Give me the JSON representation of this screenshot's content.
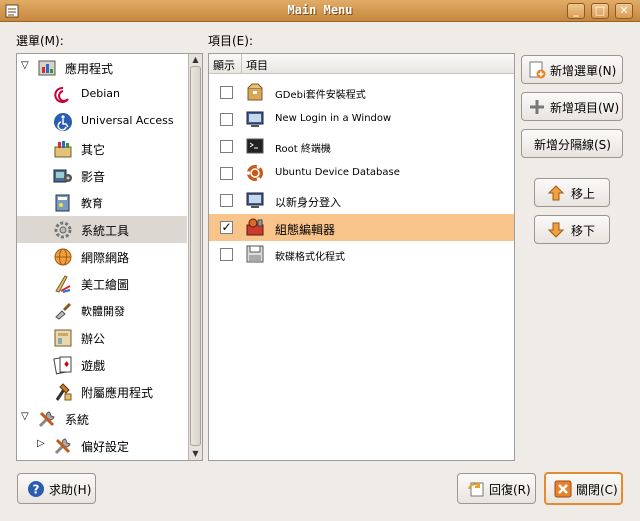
{
  "window": {
    "title": "Main Menu",
    "minimize": "_",
    "maximize": "□",
    "close": "✕"
  },
  "menus_label": "選單(M):",
  "items_label": "項目(E):",
  "menus": [
    {
      "label": "應用程式"
    },
    {
      "label": "Debian"
    },
    {
      "label": "Universal Access"
    },
    {
      "label": "其它"
    },
    {
      "label": "影音"
    },
    {
      "label": "教育"
    },
    {
      "label": "系統工具"
    },
    {
      "label": "網際網路"
    },
    {
      "label": "美工繪圖"
    },
    {
      "label": "軟體開發"
    },
    {
      "label": "辦公"
    },
    {
      "label": "遊戲"
    },
    {
      "label": "附屬應用程式"
    },
    {
      "label": "系統"
    },
    {
      "label": "偏好設定"
    }
  ],
  "columns": {
    "show": "顯示",
    "item": "項目"
  },
  "items": [
    {
      "label": "GDebi套件安裝程式",
      "checked": false
    },
    {
      "label": "New Login in a Window",
      "checked": false
    },
    {
      "label": "Root 終端機",
      "checked": false
    },
    {
      "label": "Ubuntu Device Database",
      "checked": false
    },
    {
      "label": "以新身分登入",
      "checked": false
    },
    {
      "label": "組態編輯器",
      "checked": true
    },
    {
      "label": "軟碟格式化程式",
      "checked": false
    }
  ],
  "buttons": {
    "new_menu": "新增選單(N)",
    "new_item": "新增項目(W)",
    "new_separator": "新增分隔線(S)",
    "move_up": "移上",
    "move_down": "移下",
    "help": "求助(H)",
    "revert": "回復(R)",
    "close": "關閉(C)"
  },
  "check_mark": "✓"
}
